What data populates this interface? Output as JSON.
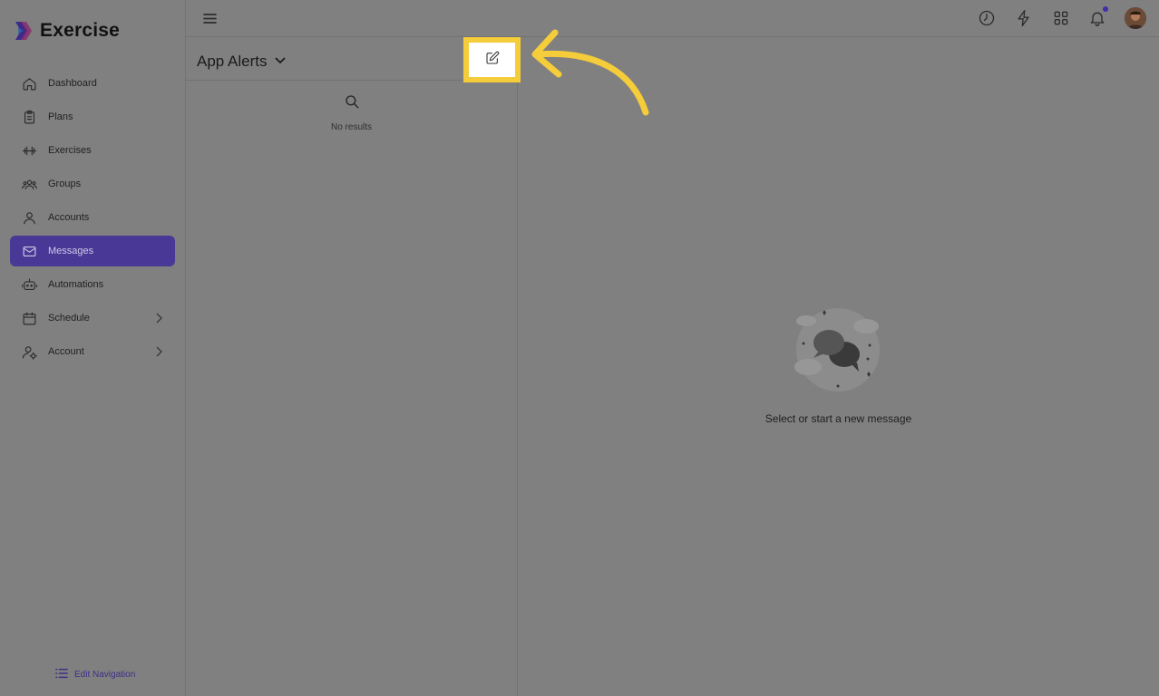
{
  "app": {
    "name": "Exercise"
  },
  "sidebar": {
    "items": [
      {
        "label": "Dashboard",
        "icon": "home-icon"
      },
      {
        "label": "Plans",
        "icon": "clipboard-icon"
      },
      {
        "label": "Exercises",
        "icon": "dumbbell-icon"
      },
      {
        "label": "Groups",
        "icon": "users-icon"
      },
      {
        "label": "Accounts",
        "icon": "user-icon"
      },
      {
        "label": "Messages",
        "icon": "mail-icon",
        "active": true
      },
      {
        "label": "Automations",
        "icon": "robot-icon"
      },
      {
        "label": "Schedule",
        "icon": "calendar-icon",
        "expandable": true
      },
      {
        "label": "Account",
        "icon": "user-settings-icon",
        "expandable": true
      }
    ],
    "edit_navigation": "Edit Navigation"
  },
  "topbar": {
    "icons": [
      "history-icon",
      "lightning-icon",
      "apps-grid-icon",
      "bell-icon",
      "avatar"
    ]
  },
  "messages": {
    "inbox_label": "App Alerts",
    "list_empty_text": "No results",
    "chat_empty_text": "Select or start a new message"
  },
  "colors": {
    "active_nav": "#4a3896",
    "highlight": "#f5cc3a",
    "overlay_bg": "#808080"
  }
}
